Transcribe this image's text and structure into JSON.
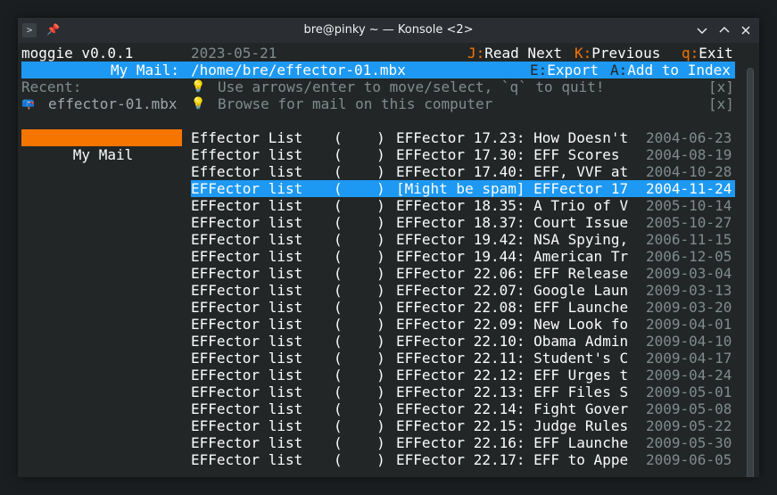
{
  "window": {
    "title": "bre@pinky ~ — Konsole <2>",
    "app_icon": ">",
    "pin_icon": "📌"
  },
  "header": {
    "app_name": "moggie v0.0.1",
    "date": "2023-05-21",
    "shortcuts": [
      {
        "key": "J:",
        "label": "Read Next"
      },
      {
        "key": "K:",
        "label": "Previous"
      },
      {
        "key": "q:",
        "label": "Exit"
      }
    ]
  },
  "mailbox_bar": {
    "label": "My Mail:",
    "path": "/home/bre/effector-01.mbx",
    "actions": [
      {
        "key": "E:",
        "label": "Export"
      },
      {
        "key": "A:",
        "label": "Add to Index"
      }
    ]
  },
  "sidebar": {
    "recent_label": "Recent:",
    "recent_item": "effector-01.mbx",
    "recent_icon": "📪",
    "selected_item": "My Mail"
  },
  "hints": [
    {
      "icon": "💡",
      "text": "Use arrows/enter to move/select, `q` to quit!",
      "close": "[x]"
    },
    {
      "icon": "💡",
      "text": "Browse for mail on this computer",
      "close": "[x]"
    }
  ],
  "messages": [
    {
      "from": "Effector List",
      "count": "(    )",
      "subject": "EFFector 17.23: How Doesn't",
      "date": "2004-06-23"
    },
    {
      "from": "Effector list",
      "count": "(    )",
      "subject": "EFFector 17.30: EFF Scores",
      "date": "2004-08-19"
    },
    {
      "from": "Effector list",
      "count": "(    )",
      "subject": "EFFector 17.40: EFF, VVF at",
      "date": "2004-10-28"
    },
    {
      "from": "EFFector list",
      "count": "(    )",
      "subject": "[Might be spam] EFFector 17",
      "date": "2004-11-24"
    },
    {
      "from": "EFFector list",
      "count": "(    )",
      "subject": "EFFector 18.35: A Trio of V",
      "date": "2005-10-14"
    },
    {
      "from": "EFFector list",
      "count": "(    )",
      "subject": "EFFector 18.37: Court Issue",
      "date": "2005-10-27"
    },
    {
      "from": "EFFector list",
      "count": "(    )",
      "subject": "EFFector 19.42: NSA Spying,",
      "date": "2006-11-15"
    },
    {
      "from": "EFFector list",
      "count": "(    )",
      "subject": "EFFector 19.44: American Tr",
      "date": "2006-12-05"
    },
    {
      "from": "EFFector list",
      "count": "(    )",
      "subject": "EFFector 22.06: EFF Release",
      "date": "2009-03-04"
    },
    {
      "from": "EFFector list",
      "count": "(    )",
      "subject": "EFFector 22.07: Google Laun",
      "date": "2009-03-13"
    },
    {
      "from": "EFFector list",
      "count": "(    )",
      "subject": "EFFector 22.08: EFF Launche",
      "date": "2009-03-20"
    },
    {
      "from": "EFFector list",
      "count": "(    )",
      "subject": "EFFector 22.09: New Look fo",
      "date": "2009-04-01"
    },
    {
      "from": "EFFector list",
      "count": "(    )",
      "subject": "EFFector 22.10: Obama Admin",
      "date": "2009-04-10"
    },
    {
      "from": "EFFector list",
      "count": "(    )",
      "subject": "EFFector 22.11: Student's C",
      "date": "2009-04-17"
    },
    {
      "from": "EFFector list",
      "count": "(    )",
      "subject": "EFFector 22.12: EFF Urges t",
      "date": "2009-04-24"
    },
    {
      "from": "EFFector list",
      "count": "(    )",
      "subject": "EFFector 22.13: EFF Files S",
      "date": "2009-05-01"
    },
    {
      "from": "EFFector list",
      "count": "(    )",
      "subject": "EFFector 22.14: Fight Gover",
      "date": "2009-05-08"
    },
    {
      "from": "EFFector list",
      "count": "(    )",
      "subject": "EFFector 22.15: Judge Rules",
      "date": "2009-05-22"
    },
    {
      "from": "EFFector list",
      "count": "(    )",
      "subject": "EFFector 22.16: EFF Launche",
      "date": "2009-05-30"
    },
    {
      "from": "EFFector list",
      "count": "(    )",
      "subject": "EFFector 22.17: EFF to Appe",
      "date": "2009-06-05"
    }
  ],
  "selected_index": 3,
  "colors": {
    "terminal_bg": "#232627",
    "text": "#fcfcfc",
    "accent_blue": "#1d99f3",
    "accent_orange": "#f67400",
    "dim": "#7f8c8d"
  }
}
